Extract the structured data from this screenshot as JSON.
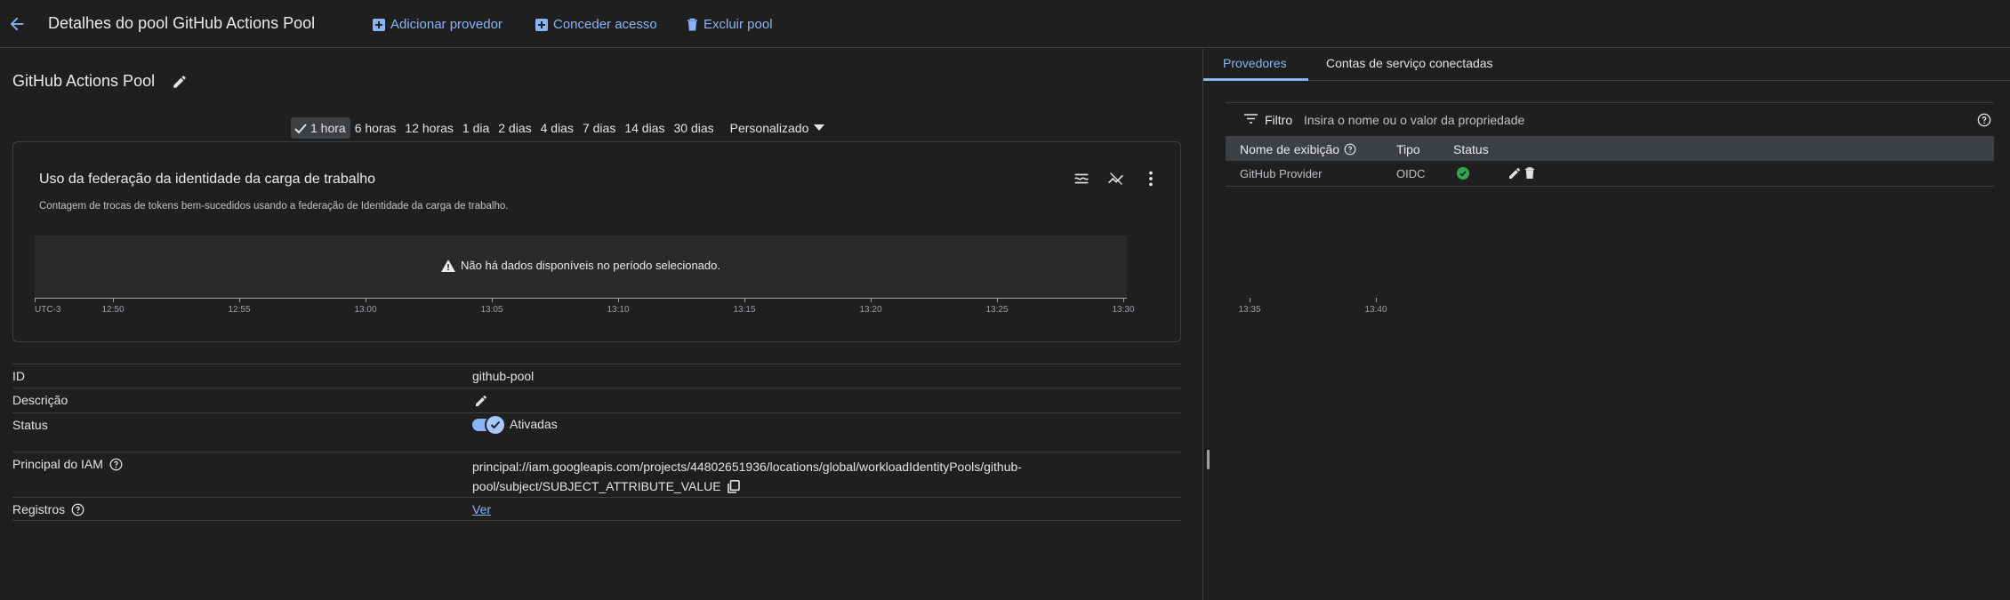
{
  "header": {
    "title": "Detalhes do pool GitHub Actions Pool",
    "actions": {
      "add_provider": "Adicionar provedor",
      "grant_access": "Conceder acesso",
      "delete_pool": "Excluir pool"
    }
  },
  "pool": {
    "name": "GitHub Actions Pool"
  },
  "time_range": {
    "options": [
      "1 hora",
      "6 horas",
      "12 horas",
      "1 dia",
      "2 dias",
      "4 dias",
      "7 dias",
      "14 dias",
      "30 dias",
      "Personalizado"
    ],
    "selected": "1 hora"
  },
  "chart": {
    "title": "Uso da federação da identidade da carga de trabalho",
    "subtitle": "Contagem de trocas de tokens bem-sucedidos usando a federação de Identidade da carga de trabalho.",
    "empty_message": "Não há dados disponíveis no período selecionado.",
    "x_ticks": [
      "UTC-3",
      "12:50",
      "12:55",
      "13:00",
      "13:05",
      "13:10",
      "13:15",
      "13:20",
      "13:25",
      "13:30",
      "13:35",
      "13:40"
    ]
  },
  "properties": {
    "id": {
      "label": "ID",
      "value": "github-pool"
    },
    "description": {
      "label": "Descrição"
    },
    "status": {
      "label": "Status",
      "value": "Ativadas",
      "enabled": true
    },
    "principal": {
      "label": "Principal do IAM",
      "value_line1": "principal://iam.googleapis.com/projects/44802651936/locations/global/workloadIdentityPools/github-",
      "value_line2": "pool/subject/SUBJECT_ATTRIBUTE_VALUE"
    },
    "logs": {
      "label": "Registros",
      "link": "Ver"
    }
  },
  "right_panel": {
    "tabs": [
      "Provedores",
      "Contas de serviço conectadas"
    ],
    "active_tab": "Provedores",
    "filter": {
      "label": "Filtro",
      "placeholder": "Insira o nome ou o valor da propriedade"
    },
    "table": {
      "headers": [
        "Nome de exibição",
        "Tipo",
        "Status"
      ],
      "rows": [
        {
          "name": "GitHub Provider",
          "type": "OIDC",
          "status": "ok"
        }
      ]
    }
  },
  "colors": {
    "accent": "#8ab4f8",
    "success": "#34a853",
    "background": "#1f1f1f"
  }
}
